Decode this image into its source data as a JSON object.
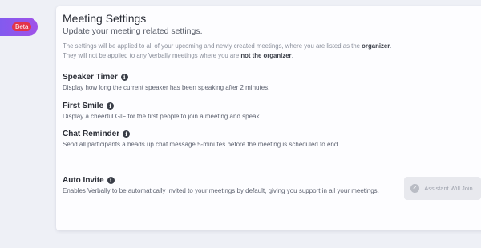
{
  "sidebar": {
    "beta_label": "Beta"
  },
  "header": {
    "title": "Meeting Settings",
    "subtitle": "Update your meeting related settings."
  },
  "notice": {
    "line1_prefix": "The settings will be applied to all of your upcoming and newly created meetings, where you are listed as the ",
    "line1_bold": "organizer",
    "line1_suffix": ".",
    "line2_prefix": "They will not be applied to any Verbally meetings where you are ",
    "line2_bold": "not the organizer",
    "line2_suffix": "."
  },
  "settings": [
    {
      "title": "Speaker Timer",
      "description": "Display how long the current speaker has been speaking after 2 minutes.",
      "icon": "info-icon"
    },
    {
      "title": "First Smile",
      "description": "Display a cheerful GIF for the first people to join a meeting and speak.",
      "icon": "info-icon"
    },
    {
      "title": "Chat Reminder",
      "description": "Send all participants a heads up chat message 5-minutes before the meeting is scheduled to end.",
      "icon": "info-icon"
    },
    {
      "title": "Auto Invite",
      "description": "Enables Verbally to be automatically invited to your meetings by default, giving you support in all your meetings.",
      "icon": "info-icon"
    }
  ],
  "assistant_button": {
    "label": "Assistant Will Join",
    "icon": "check-circle-icon",
    "state": "disabled"
  },
  "colors": {
    "accent_gradient_start": "#7c5cf0",
    "accent_gradient_end": "#a052e8",
    "beta_badge": "#e3344a",
    "page_background": "#eef0f6"
  }
}
